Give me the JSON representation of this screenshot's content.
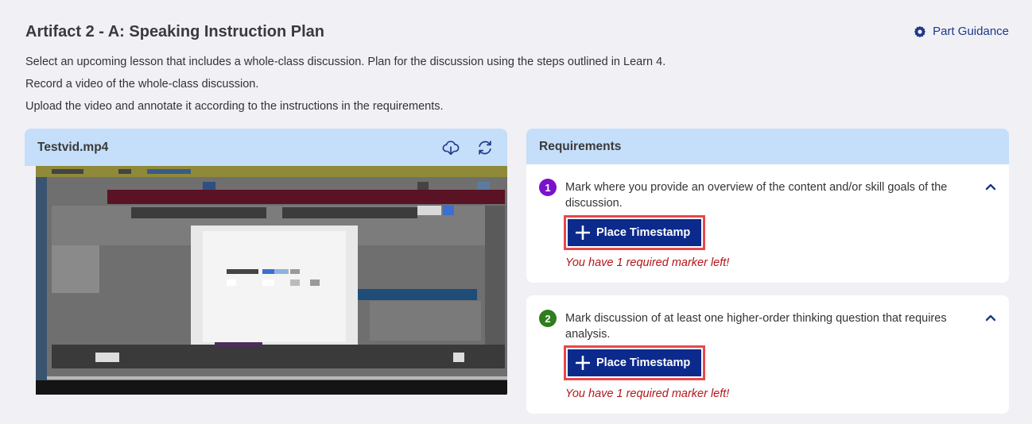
{
  "header": {
    "title": "Artifact 2 - A: Speaking Instruction Plan",
    "guidance_label": "Part Guidance"
  },
  "instructions": [
    "Select an upcoming lesson that includes a whole-class discussion. Plan for the discussion using the steps outlined in Learn 4.",
    "Record a video of the whole-class discussion.",
    "Upload the video and annotate it according to the instructions in the requirements."
  ],
  "video": {
    "filename": "Testvid.mp4",
    "download_icon": "cloud-download-icon",
    "refresh_icon": "refresh-icon"
  },
  "requirements": {
    "title": "Requirements",
    "items": [
      {
        "number": "1",
        "color": "#7a12c9",
        "text": "Mark where you provide an overview of the content and/or skill goals of the discussion.",
        "button_label": "Place Timestamp",
        "warning": "You have 1 required marker left!"
      },
      {
        "number": "2",
        "color": "#2e7d1f",
        "text": "Mark discussion of at least one higher-order thinking question that requires analysis.",
        "button_label": "Place Timestamp",
        "warning": "You have 1 required marker left!"
      }
    ]
  },
  "colors": {
    "accent": "#0b2a8c",
    "header_bg": "#c5def9",
    "warning": "#b3161b",
    "highlight_border": "#e8474a"
  }
}
